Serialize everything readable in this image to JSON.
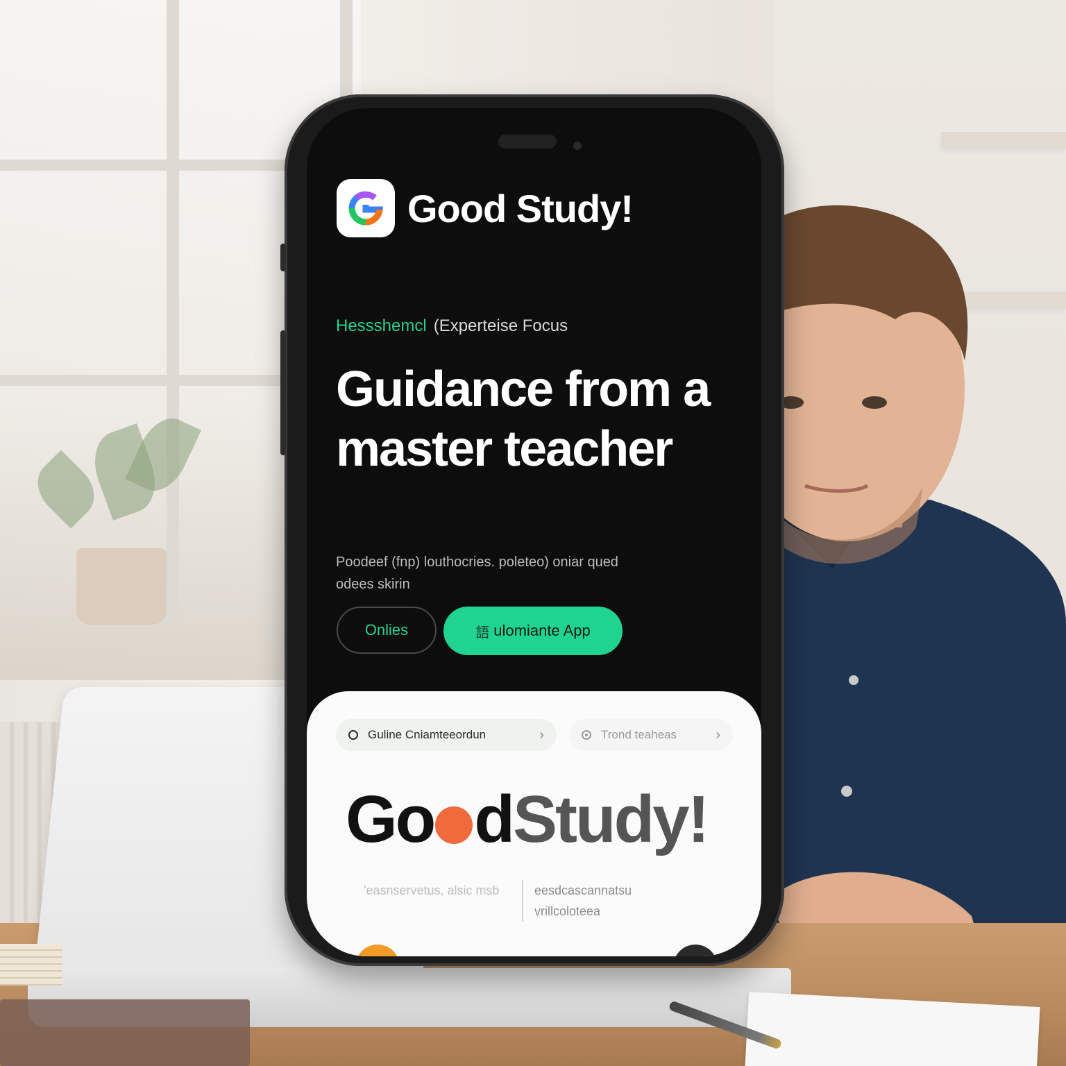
{
  "app": {
    "brand_name": "Good Study!"
  },
  "hero": {
    "eyebrow_accent": "Hessshemcl",
    "eyebrow_rest": "(Experteise Focus",
    "headline": "Guidance from a master teacher",
    "subtext": "Poodeef (fnp) louthocries. poleteo) oniar qued odees skirin"
  },
  "actions": {
    "secondary_label": "Onlies",
    "primary_prefix": "語 ",
    "primary_label": "ulomiante App"
  },
  "chips": [
    {
      "label": "Guline Cniamteeordun"
    },
    {
      "label": "Trond teaheas"
    }
  ],
  "wordmark": {
    "good": "Go",
    "after_o": "d",
    "study": "Study",
    "bang": "!"
  },
  "footer": {
    "left": "'easnservetus, alsic msb",
    "right": "eesdcascannatsu vrillcoloteea"
  },
  "colors": {
    "accent_green": "#1fd491",
    "accent_orange": "#f06a3b",
    "screen_bg": "#0d0d0d",
    "card_bg": "#fbfbfb"
  },
  "icons": [
    "google-g-icon",
    "circle-icon",
    "chevron-right-icon",
    "target-icon"
  ]
}
